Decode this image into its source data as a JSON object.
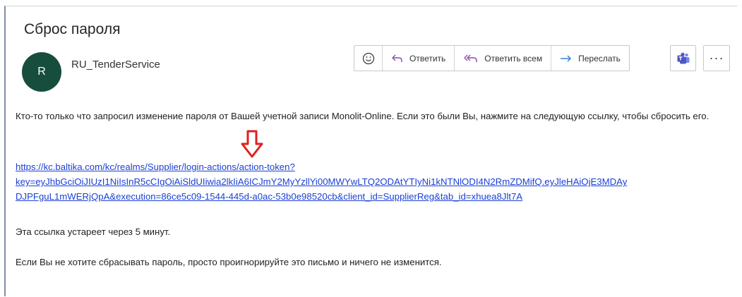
{
  "email": {
    "subject": "Сброс пароля",
    "sender_initial": "R",
    "sender_name": "RU_TenderService",
    "body": {
      "paragraph1": "Кто-то только что запросил изменение пароля от Вашей учетной записи Monolit-Online. Если это были Вы, нажмите на следующую ссылку, чтобы сбросить его.",
      "link_line1": "https://kc.baltika.com/kc/realms/Supplier/login-actions/action-token?",
      "link_line2": "key=eyJhbGciOiJIUzI1NiIsInR5cCIgOiAiSldUIiwia2lkIiA6ICJmY2MyYzllYi00MWYwLTQ2ODAtYTIyNi1kNTNlODI4N2RmZDMifQ.eyJleHAiOjE3MDAy",
      "link_line3": "DJPFguL1mWERjQpA&execution=86ce5c09-1544-445d-a0ac-53b0e98520cb&client_id=SupplierReg&tab_id=xhuea8Jlt7A",
      "paragraph2": "Эта ссылка устареет через 5 минут.",
      "paragraph3": "Если Вы не хотите сбрасывать пароль, просто проигнорируйте это письмо и ничего не изменится."
    }
  },
  "toolbar": {
    "emoji_icon": "smiley-icon",
    "reply_label": "Ответить",
    "reply_all_label": "Ответить всем",
    "forward_label": "Переслать",
    "teams_icon": "teams-icon",
    "more_label": "···"
  },
  "colors": {
    "avatar_bg": "#174d3c",
    "accent": "#8a4ea8",
    "forward_accent": "#2b79d0",
    "link": "#1a3fd6",
    "annotation_arrow": "#e02020"
  }
}
